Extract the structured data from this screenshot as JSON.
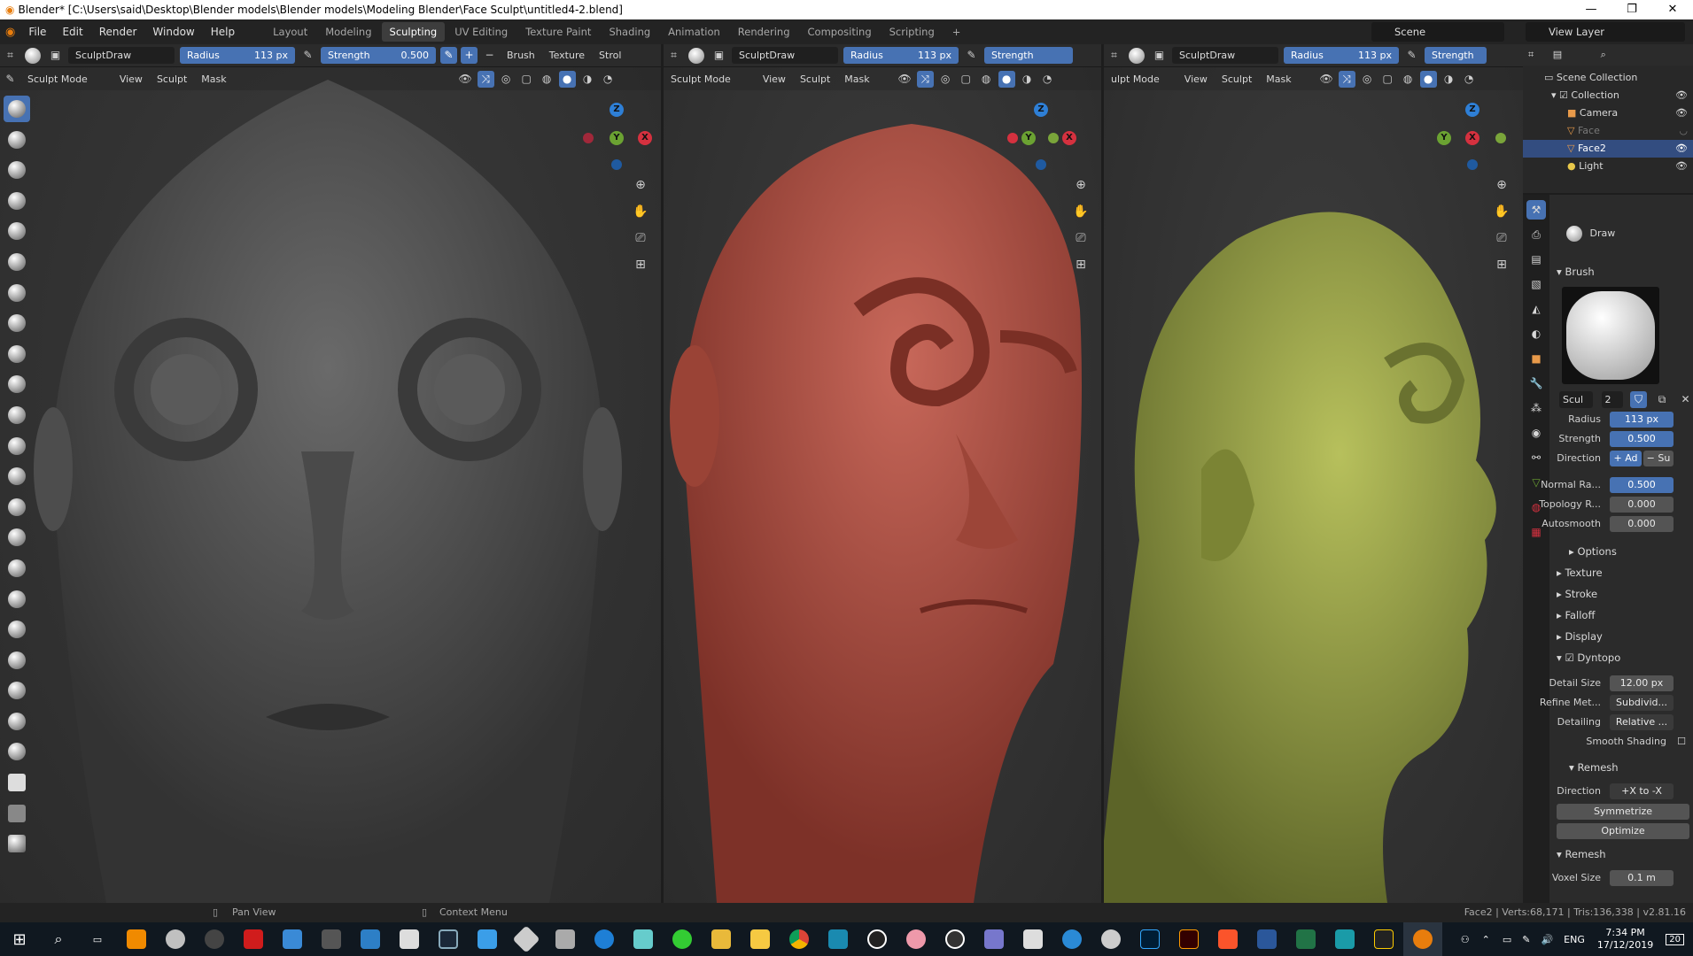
{
  "window": {
    "title": "Blender* [C:\\Users\\said\\Desktop\\Blender models\\Blender models\\Modeling Blender\\Face Sculpt\\untitled4-2.blend]"
  },
  "menus": [
    "File",
    "Edit",
    "Render",
    "Window",
    "Help"
  ],
  "workspaces": [
    "Layout",
    "Modeling",
    "Sculpting",
    "UV Editing",
    "Texture Paint",
    "Shading",
    "Animation",
    "Rendering",
    "Compositing",
    "Scripting",
    "+"
  ],
  "active_workspace": "Sculpting",
  "scene": {
    "name": "Scene",
    "view_layer": "View Layer"
  },
  "viewports": [
    {
      "brush": "SculptDraw",
      "radius_label": "Radius",
      "radius": "113 px",
      "strength_label": "Strength",
      "strength": "0.500",
      "brush_menu": "Brush",
      "texture_menu": "Texture",
      "stroke_menu": "Strol",
      "mode": "Sculpt Mode",
      "menu": [
        "View",
        "Sculpt",
        "Mask"
      ]
    },
    {
      "brush": "SculptDraw",
      "radius_label": "Radius",
      "radius": "113 px",
      "strength_label": "Strength",
      "mode": "Sculpt Mode",
      "menu": [
        "View",
        "Sculpt",
        "Mask"
      ]
    },
    {
      "brush": "SculptDraw",
      "radius_label": "Radius",
      "radius": "113 px",
      "strength_label": "Strength",
      "mode": "ulpt Mode",
      "menu": [
        "View",
        "Sculpt",
        "Mask"
      ]
    }
  ],
  "outliner": {
    "root": "Scene Collection",
    "collection": "Collection",
    "items": [
      "Camera",
      "Face",
      "Face2",
      "Light"
    ],
    "selected": "Face2"
  },
  "properties": {
    "tool_name": "Draw",
    "brush_section": "Brush",
    "brush_name_short": "Scul",
    "brush_users": "2",
    "radius_label": "Radius",
    "radius": "113 px",
    "strength_label": "Strength",
    "strength": "0.500",
    "direction_label": "Direction",
    "dir_add": "+ Ad",
    "dir_sub": "− Su",
    "normal_label": "Normal Ra...",
    "normal": "0.500",
    "topology_label": "Topology R...",
    "topology": "0.000",
    "autosmooth_label": "Autosmooth",
    "autosmooth": "0.000",
    "options": "Options",
    "sections": [
      "Texture",
      "Stroke",
      "Falloff",
      "Display"
    ],
    "dyntopo": "Dyntopo",
    "detail_size_label": "Detail Size",
    "detail_size": "12.00 px",
    "refine_label": "Refine Met...",
    "refine": "Subdivid...",
    "detailing_label": "Detailing",
    "detailing": "Relative ...",
    "smooth_shading": "Smooth Shading",
    "remesh_sub": "Remesh",
    "direction2_label": "Direction",
    "direction2": "+X to -X",
    "symmetrize": "Symmetrize",
    "optimize": "Optimize",
    "remesh": "Remesh",
    "voxel_label": "Voxel Size",
    "voxel": "0.1 m"
  },
  "status": {
    "pan": "Pan View",
    "context": "Context Menu",
    "stats": "Face2 | Verts:68,171 | Tris:136,338 | v2.81.16"
  },
  "taskbar": {
    "lang": "ENG",
    "time": "7:34 PM",
    "date": "17/12/2019",
    "notif": "20"
  },
  "colors": {
    "accent": "#4772b3",
    "head1": "#565656",
    "head2": "#a44a3e",
    "head3": "#8f9a43"
  }
}
